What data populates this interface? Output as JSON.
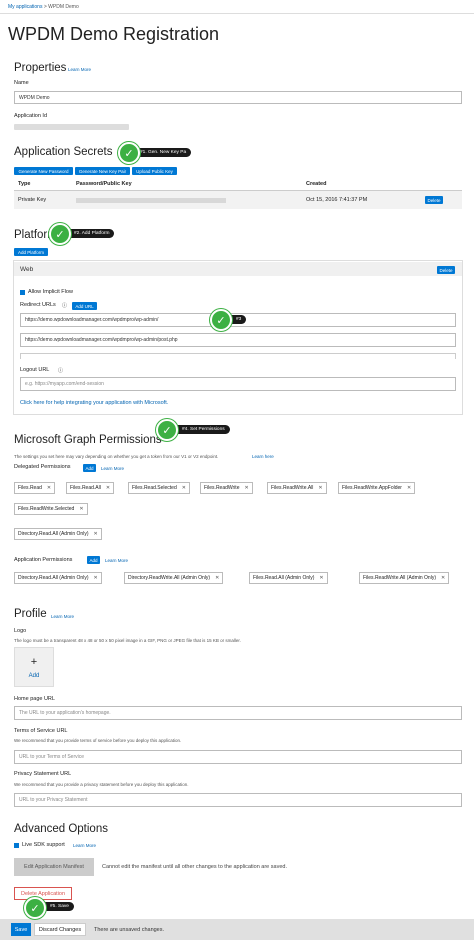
{
  "breadcrumb": {
    "parent": "My applications",
    "sep": ">",
    "current": "WPDM Demo"
  },
  "page_title": "WPDM Demo Registration",
  "properties": {
    "title": "Properties",
    "learn_more": "Learn More",
    "name_label": "Name",
    "name_value": "WPDM Demo",
    "app_id_label": "Application Id"
  },
  "secrets": {
    "title": "Application Secrets",
    "btn_password": "Generate New Password",
    "btn_keypair": "Generate New Key Pair",
    "btn_upload": "Upload Public Key",
    "col_type": "Type",
    "col_key": "Password/Public Key",
    "col_created": "Created",
    "row_type": "Private Key",
    "row_created": "Oct 15, 2016 7:41:37 PM",
    "row_delete": "Delete"
  },
  "platforms": {
    "title": "Platforms",
    "add_btn": "Add Platform",
    "web_title": "Web",
    "delete_btn": "Delete",
    "implicit_flow": "Allow Implicit Flow",
    "redirect_label": "Redirect URLs",
    "add_url_btn": "Add URL",
    "url1": "https://demo.wpdownloadmanager.com/wpdmpro/wp-admin/",
    "url2": "https://demo.wpdownloadmanager.com/wpdmpro/wp-admin/post.php",
    "logout_label": "Logout URL",
    "logout_placeholder": "e.g. https://myapp.com/end-session",
    "help_link": "Click here for help integrating your application with Microsoft."
  },
  "graph": {
    "title": "Microsoft Graph Permissions",
    "desc": "The settings you set here may vary depending on whether you get a token from our V1 or V2 endpoint.",
    "learn_here": "Learn here",
    "delegated_label": "Delegated Permissions",
    "add": "Add",
    "learn_more": "Learn More",
    "delegated": [
      "Files.Read",
      "Files.Read.All",
      "Files.Read.Selected",
      "Files.ReadWrite",
      "Files.ReadWrite.All",
      "Files.ReadWrite.AppFolder",
      "Files.ReadWrite.Selected",
      "Directory.Read.All (Admin Only)"
    ],
    "application_label": "Application Permissions",
    "application": [
      "Directory.Read.All (Admin Only)",
      "Directory.ReadWrite.All (Admin Only)",
      "Files.Read.All (Admin Only)",
      "Files.ReadWrite.All (Admin Only)"
    ]
  },
  "profile": {
    "title": "Profile",
    "learn_more": "Learn More",
    "logo_label": "Logo",
    "logo_desc": "The logo must be a transparent 48 x 48 or 50 x 50 pixel image in a GIF, PNG or JPEG file that is 15 KB or smaller.",
    "logo_add": "Add",
    "logo_plus": "+",
    "home_label": "Home page URL",
    "home_placeholder": "The URL to your application's homepage.",
    "tos_label": "Terms of Service URL",
    "tos_desc": "We recommend that you provide terms of service before you deploy this application.",
    "tos_placeholder": "URL to your Terms of Service",
    "privacy_label": "Privacy Statement URL",
    "privacy_desc": "We recommend that you provide a privacy statement before you deploy this application.",
    "privacy_placeholder": "URL to your Privacy Statement"
  },
  "advanced": {
    "title": "Advanced Options",
    "live_sdk": "Live SDK support",
    "learn_more": "Learn More",
    "manifest_btn": "Edit Application Manifest",
    "manifest_note": "Cannot edit the manifest until all other changes to the application are saved.",
    "delete_app": "Delete Application"
  },
  "footer": {
    "save": "Save",
    "discard": "Discard Changes",
    "unsaved": "There are unsaved changes."
  },
  "callouts": {
    "c1": "#1. Gen. New Key Pa",
    "c2": "#2. Add Platform",
    "c3": "#3",
    "c4": "#4. Set Permissions",
    "c5": "#5. Save",
    "check": "✓"
  },
  "colors": {
    "accent": "#0078d4",
    "callout": "#3cb043",
    "danger": "#d9534f"
  }
}
